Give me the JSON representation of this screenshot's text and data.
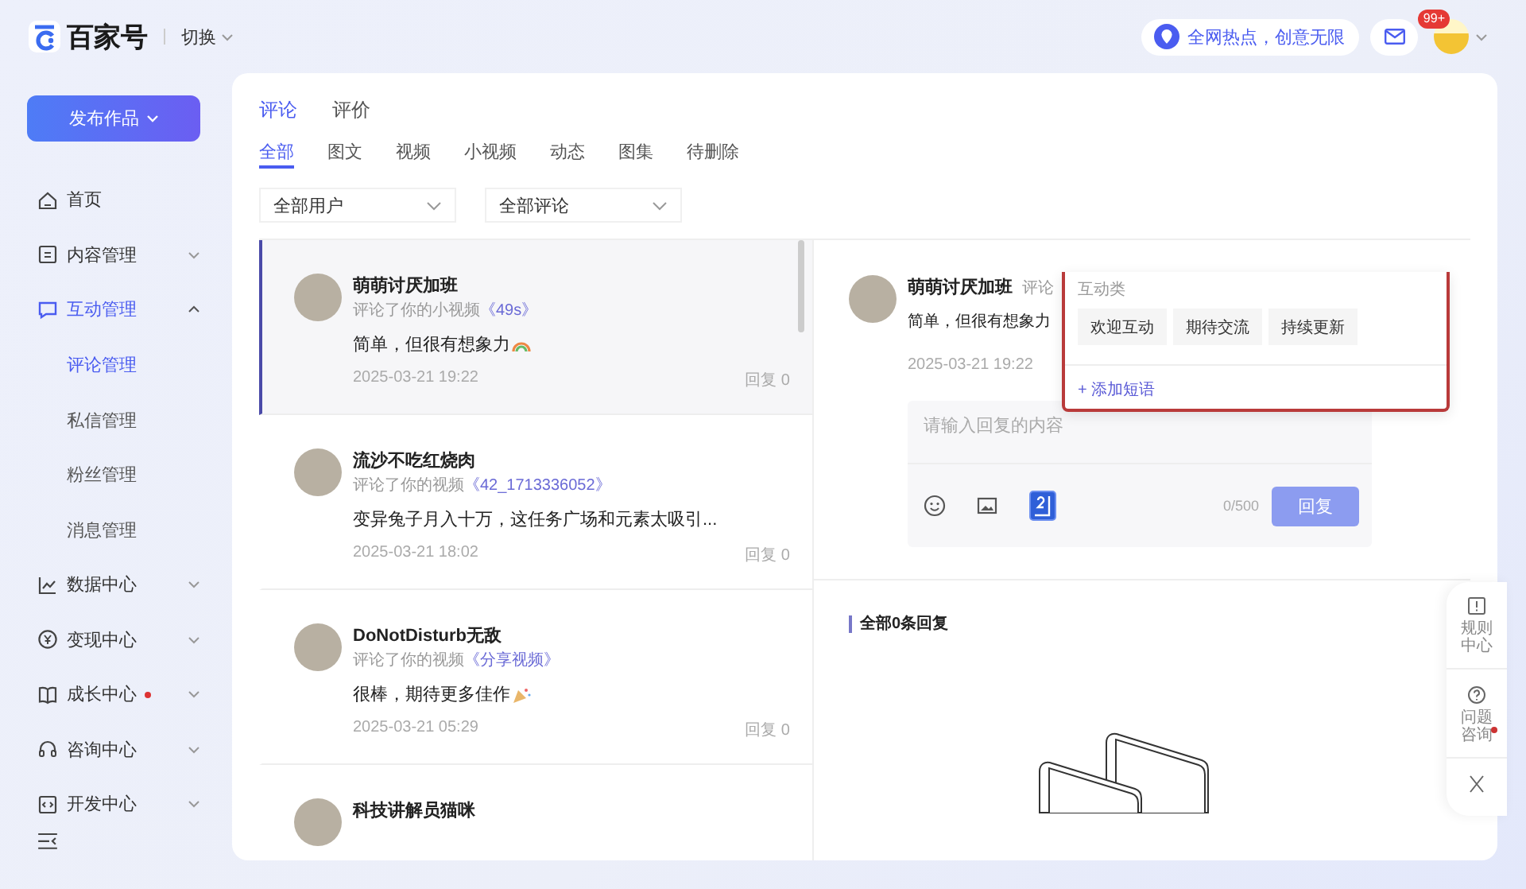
{
  "header": {
    "logo": "百家号",
    "switch": "切换",
    "hot_pill": "全网热点，创意无限",
    "mail_badge": "99+"
  },
  "sidebar": {
    "publish": "发布作品",
    "items": [
      {
        "kind": "link",
        "label": "首页"
      },
      {
        "kind": "group",
        "label": "内容管理",
        "expanded": false,
        "dot": false
      },
      {
        "kind": "group",
        "label": "互动管理",
        "expanded": true,
        "dot": false,
        "children": [
          {
            "label": "评论管理",
            "selected": true
          },
          {
            "label": "私信管理",
            "selected": false
          },
          {
            "label": "粉丝管理",
            "selected": false
          },
          {
            "label": "消息管理",
            "selected": false
          }
        ]
      },
      {
        "kind": "group",
        "label": "数据中心",
        "expanded": false,
        "dot": false
      },
      {
        "kind": "group",
        "label": "变现中心",
        "expanded": false,
        "dot": false
      },
      {
        "kind": "group",
        "label": "成长中心",
        "expanded": false,
        "dot": true
      },
      {
        "kind": "group",
        "label": "咨询中心",
        "expanded": false,
        "dot": false
      },
      {
        "kind": "group",
        "label": "开发中心",
        "expanded": false,
        "dot": false
      }
    ]
  },
  "tabs": [
    {
      "label": "评论",
      "selected": true
    },
    {
      "label": "评价",
      "selected": false
    }
  ],
  "sub_tabs": [
    {
      "label": "全部",
      "selected": true
    },
    {
      "label": "图文",
      "selected": false
    },
    {
      "label": "视频",
      "selected": false
    },
    {
      "label": "小视频",
      "selected": false
    },
    {
      "label": "动态",
      "selected": false
    },
    {
      "label": "图集",
      "selected": false
    },
    {
      "label": "待删除",
      "selected": false
    }
  ],
  "filters": [
    {
      "value": "全部用户"
    },
    {
      "value": "全部评论"
    }
  ],
  "comments": [
    {
      "name": "萌萌讨厌加班",
      "action": "评论了你的小视频",
      "work": "《49s》",
      "text": "简单，但很有想象力",
      "emoji": true,
      "time": "2025-03-21 19:22",
      "reply": "回复 0",
      "selected": true
    },
    {
      "name": "流沙不吃红烧肉",
      "action": "评论了你的视频",
      "work": "《42_1713336052》",
      "text": "变异兔子月入十万，这任务广场和元素太吸引...",
      "emoji": false,
      "time": "2025-03-21 18:02",
      "reply": "回复 0",
      "selected": false
    },
    {
      "name": "DoNotDisturb无敌",
      "action": "评论了你的视频",
      "work": "《分享视频》",
      "text": "很棒，期待更多佳作",
      "emoji": true,
      "time": "2025-03-21 05:29",
      "reply": "回复 0",
      "selected": false
    },
    {
      "name": "科技讲解员猫咪"
    }
  ],
  "detail": {
    "name": "萌萌讨厌加班",
    "action": "评论",
    "text": "简单，但很有想象力",
    "time": "2025-03-21 19:22",
    "reply_placeholder": "请输入回复的内容",
    "counter": "0/500",
    "reply_button": "回复",
    "reply_disabled": true,
    "replies_title": "全部0条回复"
  },
  "phrase_popup": {
    "title": "互动类",
    "phrases": [
      "欢迎互动",
      "期待交流",
      "持续更新"
    ],
    "add": "+ 添加短语"
  },
  "quick_panel": {
    "items": [
      {
        "label": "规则中心",
        "dot": false
      },
      {
        "label": "问题咨询",
        "dot": true
      }
    ]
  }
}
